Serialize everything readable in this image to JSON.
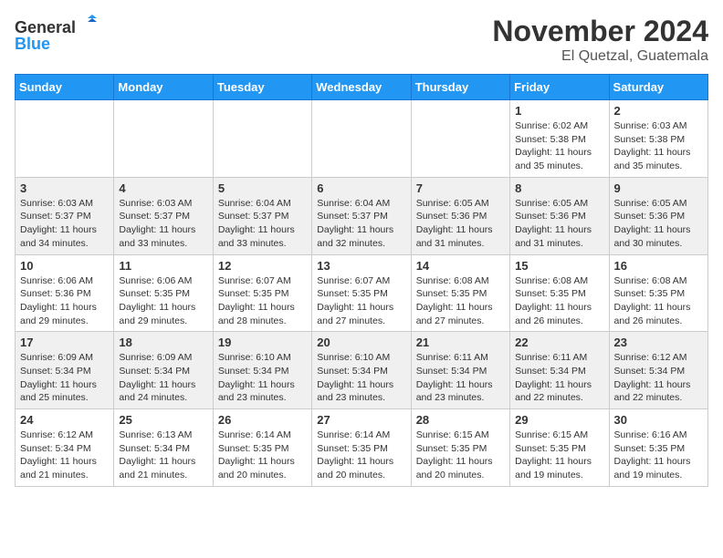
{
  "header": {
    "logo": {
      "general": "General",
      "blue": "Blue"
    },
    "title": "November 2024",
    "location": "El Quetzal, Guatemala"
  },
  "weekdays": [
    "Sunday",
    "Monday",
    "Tuesday",
    "Wednesday",
    "Thursday",
    "Friday",
    "Saturday"
  ],
  "weeks": [
    {
      "days": [
        {
          "date": "",
          "info": ""
        },
        {
          "date": "",
          "info": ""
        },
        {
          "date": "",
          "info": ""
        },
        {
          "date": "",
          "info": ""
        },
        {
          "date": "",
          "info": ""
        },
        {
          "date": "1",
          "info": "Sunrise: 6:02 AM\nSunset: 5:38 PM\nDaylight: 11 hours\nand 35 minutes."
        },
        {
          "date": "2",
          "info": "Sunrise: 6:03 AM\nSunset: 5:38 PM\nDaylight: 11 hours\nand 35 minutes."
        }
      ]
    },
    {
      "days": [
        {
          "date": "3",
          "info": "Sunrise: 6:03 AM\nSunset: 5:37 PM\nDaylight: 11 hours\nand 34 minutes."
        },
        {
          "date": "4",
          "info": "Sunrise: 6:03 AM\nSunset: 5:37 PM\nDaylight: 11 hours\nand 33 minutes."
        },
        {
          "date": "5",
          "info": "Sunrise: 6:04 AM\nSunset: 5:37 PM\nDaylight: 11 hours\nand 33 minutes."
        },
        {
          "date": "6",
          "info": "Sunrise: 6:04 AM\nSunset: 5:37 PM\nDaylight: 11 hours\nand 32 minutes."
        },
        {
          "date": "7",
          "info": "Sunrise: 6:05 AM\nSunset: 5:36 PM\nDaylight: 11 hours\nand 31 minutes."
        },
        {
          "date": "8",
          "info": "Sunrise: 6:05 AM\nSunset: 5:36 PM\nDaylight: 11 hours\nand 31 minutes."
        },
        {
          "date": "9",
          "info": "Sunrise: 6:05 AM\nSunset: 5:36 PM\nDaylight: 11 hours\nand 30 minutes."
        }
      ]
    },
    {
      "days": [
        {
          "date": "10",
          "info": "Sunrise: 6:06 AM\nSunset: 5:36 PM\nDaylight: 11 hours\nand 29 minutes."
        },
        {
          "date": "11",
          "info": "Sunrise: 6:06 AM\nSunset: 5:35 PM\nDaylight: 11 hours\nand 29 minutes."
        },
        {
          "date": "12",
          "info": "Sunrise: 6:07 AM\nSunset: 5:35 PM\nDaylight: 11 hours\nand 28 minutes."
        },
        {
          "date": "13",
          "info": "Sunrise: 6:07 AM\nSunset: 5:35 PM\nDaylight: 11 hours\nand 27 minutes."
        },
        {
          "date": "14",
          "info": "Sunrise: 6:08 AM\nSunset: 5:35 PM\nDaylight: 11 hours\nand 27 minutes."
        },
        {
          "date": "15",
          "info": "Sunrise: 6:08 AM\nSunset: 5:35 PM\nDaylight: 11 hours\nand 26 minutes."
        },
        {
          "date": "16",
          "info": "Sunrise: 6:08 AM\nSunset: 5:35 PM\nDaylight: 11 hours\nand 26 minutes."
        }
      ]
    },
    {
      "days": [
        {
          "date": "17",
          "info": "Sunrise: 6:09 AM\nSunset: 5:34 PM\nDaylight: 11 hours\nand 25 minutes."
        },
        {
          "date": "18",
          "info": "Sunrise: 6:09 AM\nSunset: 5:34 PM\nDaylight: 11 hours\nand 24 minutes."
        },
        {
          "date": "19",
          "info": "Sunrise: 6:10 AM\nSunset: 5:34 PM\nDaylight: 11 hours\nand 23 minutes."
        },
        {
          "date": "20",
          "info": "Sunrise: 6:10 AM\nSunset: 5:34 PM\nDaylight: 11 hours\nand 23 minutes."
        },
        {
          "date": "21",
          "info": "Sunrise: 6:11 AM\nSunset: 5:34 PM\nDaylight: 11 hours\nand 23 minutes."
        },
        {
          "date": "22",
          "info": "Sunrise: 6:11 AM\nSunset: 5:34 PM\nDaylight: 11 hours\nand 22 minutes."
        },
        {
          "date": "23",
          "info": "Sunrise: 6:12 AM\nSunset: 5:34 PM\nDaylight: 11 hours\nand 22 minutes."
        }
      ]
    },
    {
      "days": [
        {
          "date": "24",
          "info": "Sunrise: 6:12 AM\nSunset: 5:34 PM\nDaylight: 11 hours\nand 21 minutes."
        },
        {
          "date": "25",
          "info": "Sunrise: 6:13 AM\nSunset: 5:34 PM\nDaylight: 11 hours\nand 21 minutes."
        },
        {
          "date": "26",
          "info": "Sunrise: 6:14 AM\nSunset: 5:35 PM\nDaylight: 11 hours\nand 20 minutes."
        },
        {
          "date": "27",
          "info": "Sunrise: 6:14 AM\nSunset: 5:35 PM\nDaylight: 11 hours\nand 20 minutes."
        },
        {
          "date": "28",
          "info": "Sunrise: 6:15 AM\nSunset: 5:35 PM\nDaylight: 11 hours\nand 20 minutes."
        },
        {
          "date": "29",
          "info": "Sunrise: 6:15 AM\nSunset: 5:35 PM\nDaylight: 11 hours\nand 19 minutes."
        },
        {
          "date": "30",
          "info": "Sunrise: 6:16 AM\nSunset: 5:35 PM\nDaylight: 11 hours\nand 19 minutes."
        }
      ]
    }
  ]
}
